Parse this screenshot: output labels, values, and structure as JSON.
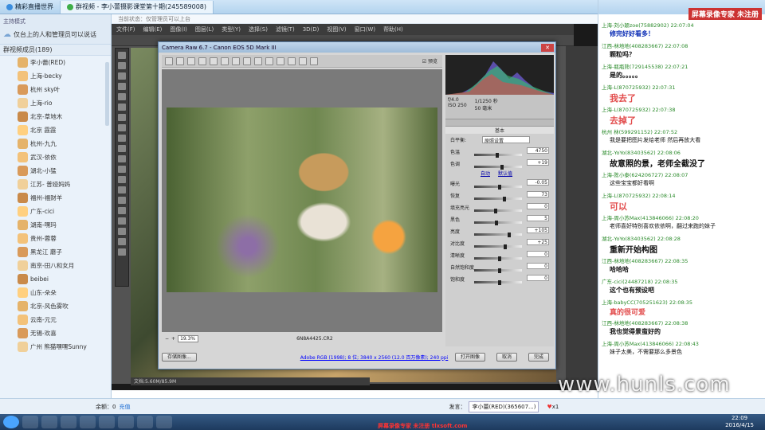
{
  "title_tabs": [
    {
      "label": "精彩直播世界"
    },
    {
      "label": "群视频 - 李小蕾摄影课堂第十期(245589008)"
    }
  ],
  "left_panel": {
    "notice": "主持模式",
    "notice_text": "仅台上的人和管理员可以说话",
    "members_header": "群视频成员(189)",
    "members": [
      "李小蕾(RED)",
      "上海-becky",
      "杭州 sky叶",
      "上海-rio",
      "北京-草地木",
      "北京 霞霞",
      "杭州-九九",
      "武汉-依依",
      "湖北-小猛",
      "江苏- 普娅妈妈",
      "福州-福财羊",
      "广东-cici",
      "湖南-嘿玛",
      "贵州-蓉蓉",
      "黑龙江 蘑子",
      "南京-田八和女月",
      "beibei",
      "山东-朵朵",
      "北京-风色雾吹",
      "云南-元元",
      "无锡-欢喜",
      "广州 熊猫嘿嘿Sunny"
    ]
  },
  "center": {
    "notice": "当前状态：仅管理员可以上台"
  },
  "photoshop": {
    "menu": [
      "文件(F)",
      "编辑(E)",
      "图像(I)",
      "图层(L)",
      "类型(Y)",
      "选择(S)",
      "滤镜(T)",
      "3D(D)",
      "视图(V)",
      "窗口(W)",
      "帮助(H)"
    ],
    "status": "文档:5.60M/85.9M"
  },
  "camera_raw": {
    "title": "Camera Raw 6.7 - Canon EOS 5D Mark III",
    "preview_label": "预览",
    "zoom": "19.3%",
    "filename": "6N8A4425.CR2",
    "workflow_link": "Adobe RGB (1998); 8 位; 3840 x 2560 (12.0 百万像素); 240 ppi",
    "readout": {
      "f": "f/4.0",
      "shutter": "1/1250 秒",
      "iso": "ISO 250",
      "focal": "50 毫米"
    },
    "panel_title": "基本",
    "wb_label": "白平衡:",
    "wb_value": "原照设置",
    "auto_link": "自动",
    "default_link": "默认值",
    "sliders": [
      {
        "label": "色温",
        "value": "4750"
      },
      {
        "label": "色调",
        "value": "+19"
      },
      {
        "label": "曝光",
        "value": "-0.05"
      },
      {
        "label": "恢复",
        "value": "73"
      },
      {
        "label": "填充亮光",
        "value": "0"
      },
      {
        "label": "黑色",
        "value": "5"
      },
      {
        "label": "亮度",
        "value": "+105"
      },
      {
        "label": "对比度",
        "value": "+25"
      },
      {
        "label": "清晰度",
        "value": "0"
      },
      {
        "label": "自然饱和度",
        "value": "0"
      },
      {
        "label": "饱和度",
        "value": "0"
      }
    ],
    "buttons": {
      "save": "存储图像...",
      "open": "打开图像",
      "cancel": "取消",
      "done": "完成"
    }
  },
  "chat": {
    "watermark": "屏幕录像专家 未注册",
    "messages": [
      {
        "meta": "上海-刘小颖zoe(75882902) 22:07:04",
        "text": "修完好好看多！",
        "style": "blue"
      },
      {
        "meta": "江西-林地地(408283667) 22:07:08",
        "text": "颗粒吗？",
        "style": "dark"
      },
      {
        "meta": "上海-瓶瓶熊(729145538) 22:07:21",
        "text": "是的。。。。。",
        "style": "dark"
      },
      {
        "meta": "上海-L(870725932) 22:07:31",
        "text": "我去了",
        "style": "red"
      },
      {
        "meta": "上海-L(870725932) 22:07:38",
        "text": "去掉了",
        "style": "red"
      },
      {
        "meta": "杭州 林(599291152) 22:07:52",
        "text": "我是要把图片发给老师 然后再放大看",
        "style": "plain"
      },
      {
        "meta": "湖北-YoYo(83403562) 22:08:06",
        "text": "故意照的景，老师全截没了",
        "style": "big"
      },
      {
        "meta": "上海-陈小泰(624206727) 22:08:07",
        "text": "这些宝宝都好看啊",
        "style": "plain"
      },
      {
        "meta": "上海-L(870725932) 22:08:14",
        "text": "可以",
        "style": "red"
      },
      {
        "meta": "上海-周小苏Max(413846066) 22:08:20",
        "text": "老师喜好特别喜欢依依啊，翻过来跑的妹子",
        "style": "plain"
      },
      {
        "meta": "湖北-YoYo(83403562) 22:08:28",
        "text": "重新开始构图",
        "style": "big"
      },
      {
        "meta": "江西-林地地(408283667) 22:08:35",
        "text": "哈哈哈",
        "style": "dark"
      },
      {
        "meta": "广东-cici(24487218) 22:08:35",
        "text": "这个也有预设吧",
        "style": "dark"
      },
      {
        "meta": "上海-babyCC(705251623) 22:08:35",
        "text": "真的很可爱",
        "style": "redsmall"
      },
      {
        "meta": "江西-林地地(408283667) 22:08:38",
        "text": "我也觉得景蛮好的",
        "style": "dark"
      },
      {
        "meta": "上海-周小苏Max(413846066) 22:08:43",
        "text": "妹子太美，不需要那么多景色",
        "style": "plain"
      }
    ]
  },
  "input_bar": {
    "balance": "余额：0",
    "recharge": "充值",
    "speaker": "发言：",
    "speaker_value": "李小蕾(RED)(365607...)",
    "likes": "x1"
  },
  "taskbar": {
    "time": "22:09",
    "date": "2016/4/15"
  },
  "bottom_watermark": "屏幕录像专家 未注册 tlxsoft.com",
  "site_watermark": "www.hunls.com"
}
